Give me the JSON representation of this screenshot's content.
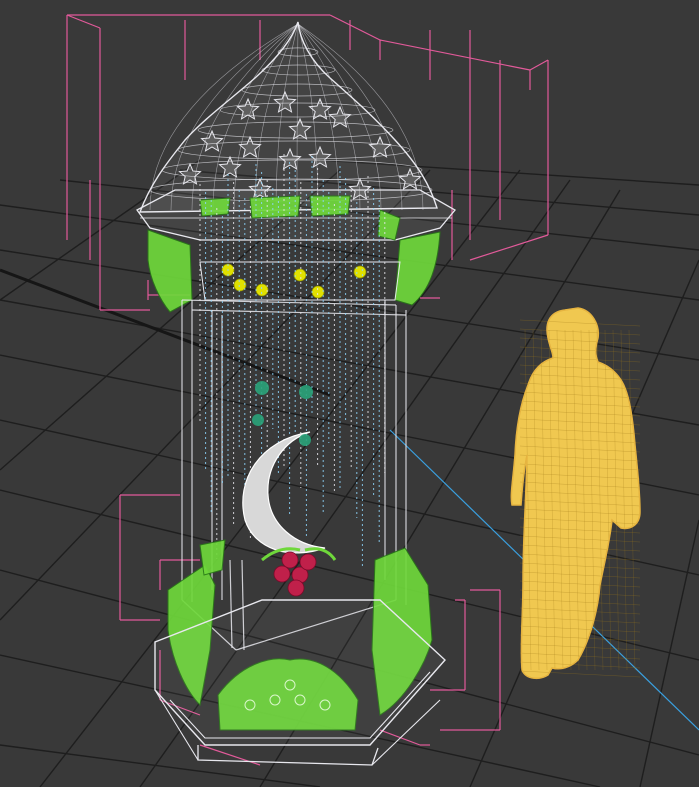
{
  "viewport": {
    "background": "#393939",
    "grid_color": "#1e1e1e",
    "selection_box_color": "#e25a9a",
    "wire_white": "#e8e8ee",
    "wire_cyan": "#8fd8ff",
    "ornament_green": "#6fd83b",
    "ornament_yellow": "#e0e000",
    "crescent_fill": "#d8d8d8",
    "flower_red": "#c0204a",
    "figure_yellow": "#f0c850",
    "axis_line_color": "#3aa0e0"
  },
  "scene": {
    "objects": [
      {
        "name": "lantern-dome",
        "icon": "onion-dome-wireframe"
      },
      {
        "name": "lantern-canopy-ring",
        "icon": "octagon-ring"
      },
      {
        "name": "lantern-body",
        "icon": "hexagonal-prism-wireframe"
      },
      {
        "name": "bead-curtains",
        "icon": "hanging-bead-strands"
      },
      {
        "name": "crescent-moon",
        "icon": "crescent"
      },
      {
        "name": "flower-cluster",
        "icon": "rose"
      },
      {
        "name": "ornament-panels",
        "icon": "arabesque-panel"
      },
      {
        "name": "lantern-base",
        "icon": "hexagonal-plinth"
      },
      {
        "name": "human-figure",
        "icon": "standing-person-in-robe"
      }
    ]
  }
}
